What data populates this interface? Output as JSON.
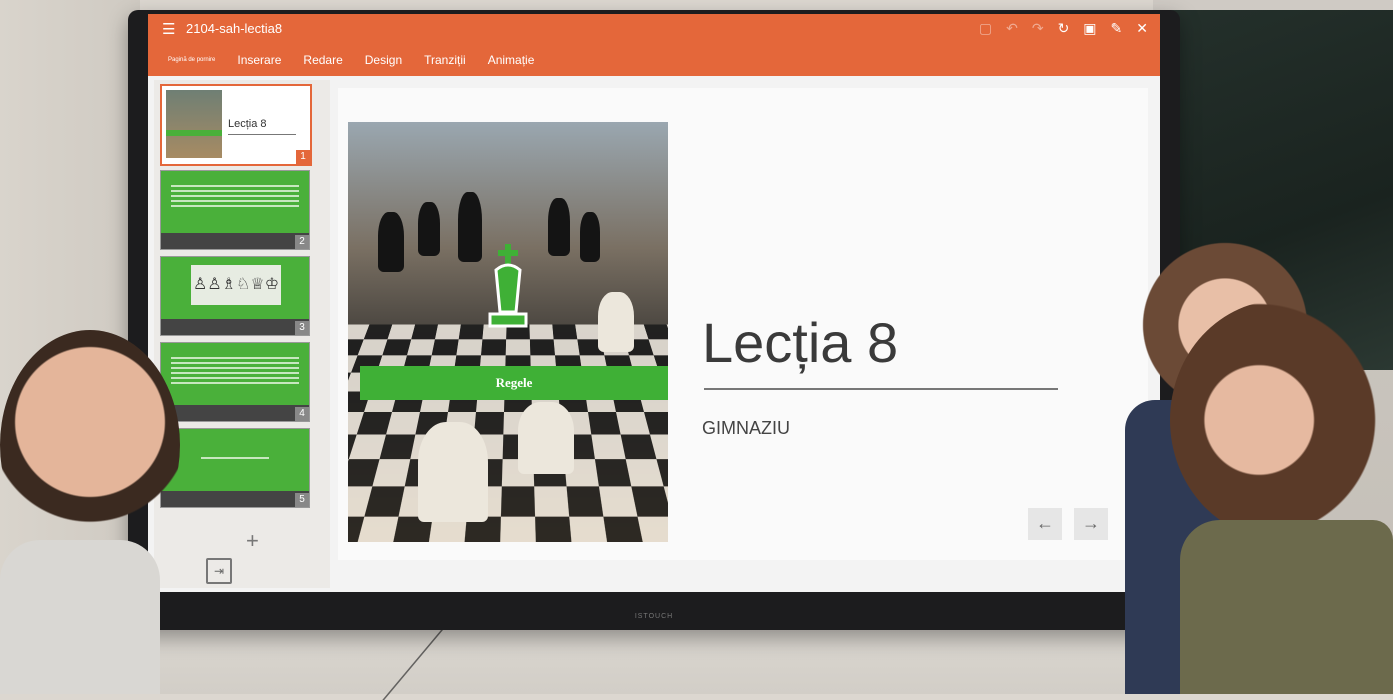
{
  "app": {
    "doc_title": "2104-sah-lectia8",
    "menu_icon": "hamburger-menu-icon"
  },
  "ribbon": {
    "tabs": [
      "Pagină de pornire",
      "Inserare",
      "Redare",
      "Design",
      "Tranziții",
      "Animație"
    ]
  },
  "toolbar": {
    "icons": [
      "save-icon",
      "undo-icon",
      "redo-icon",
      "rotate-icon",
      "present-icon",
      "pen-icon",
      "close-icon"
    ],
    "glyphs": [
      "▢",
      "↶",
      "↷",
      "↻",
      "▣",
      "✎",
      "✕"
    ]
  },
  "slides_panel": {
    "thumbs": [
      {
        "num": "1",
        "title": "Lecția 8"
      },
      {
        "num": "2"
      },
      {
        "num": "3"
      },
      {
        "num": "4"
      },
      {
        "num": "5"
      }
    ],
    "add_label": "+"
  },
  "slide": {
    "title": "Lecția 8",
    "subtitle": "GIMNAZIU",
    "banner": "Regele",
    "nav_prev": "←",
    "nav_next": "→"
  },
  "colors": {
    "accent": "#e4673a",
    "slide_green": "#3fb036"
  }
}
